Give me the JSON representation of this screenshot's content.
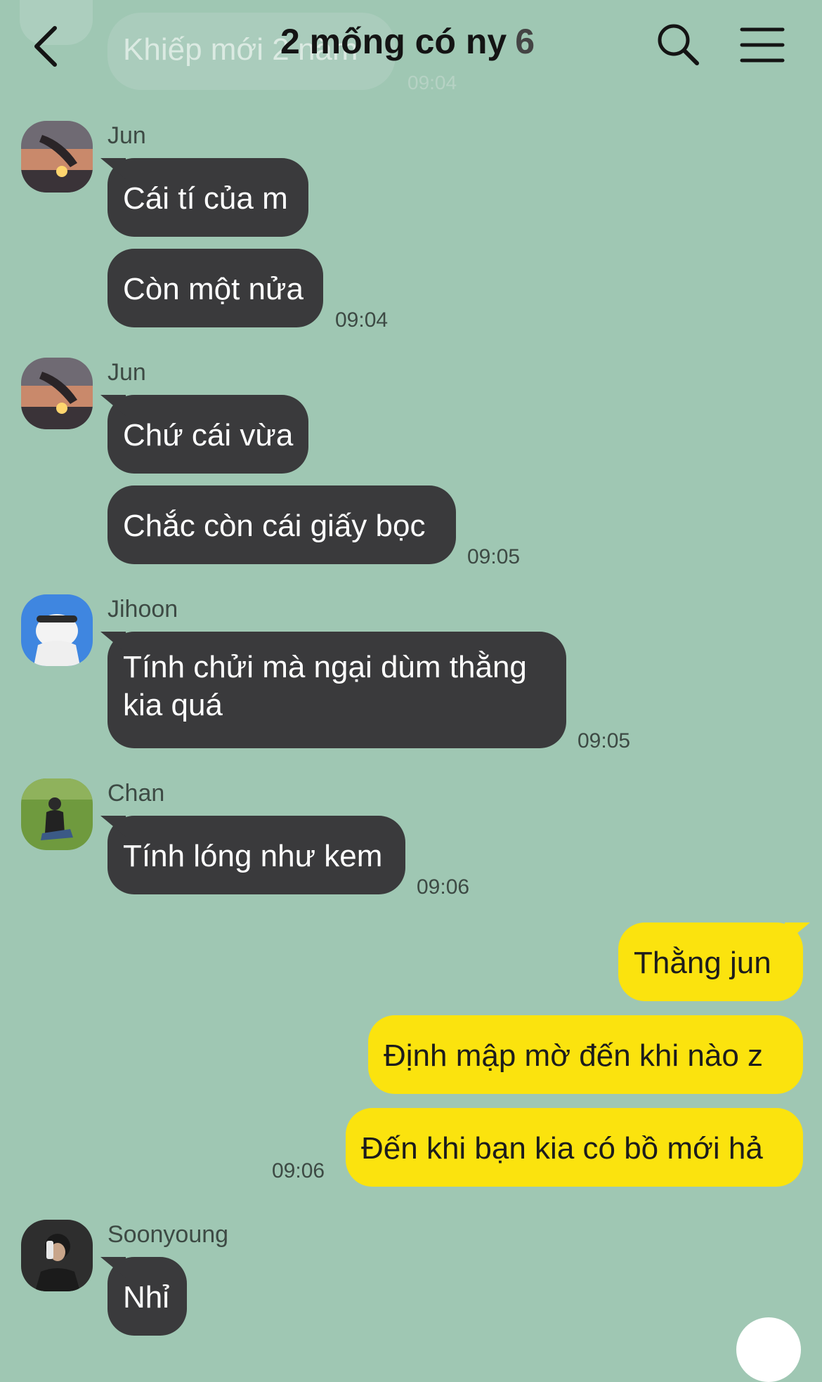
{
  "header": {
    "title": "2 mống có ny",
    "member_count": "6"
  },
  "previous_message": {
    "text": "Khiếp mới 2 năm",
    "time": "09:04"
  },
  "messages": [
    {
      "sender": "Jun",
      "bubbles": [
        "Cái tí của m",
        "Còn một nửa"
      ],
      "time": "09:04"
    },
    {
      "sender": "Jun",
      "bubbles": [
        "Chứ cái vừa",
        "Chắc còn cái giấy bọc"
      ],
      "time": "09:05"
    },
    {
      "sender": "Jihoon",
      "bubbles": [
        "Tính chửi mà ngại dùm thằng kia quá"
      ],
      "time": "09:05"
    },
    {
      "sender": "Chan",
      "bubbles": [
        "Tính lóng như kem"
      ],
      "time": "09:06"
    },
    {
      "sender": "me",
      "bubbles": [
        "Thằng jun",
        "Định mập mờ đến khi nào z",
        "Đến khi bạn kia có bồ mới hả"
      ],
      "time": "09:06"
    },
    {
      "sender": "Soonyoung",
      "bubbles": [
        "Nhỉ"
      ]
    }
  ],
  "colors": {
    "background": "#9fc7b3",
    "incoming_bubble": "#3a3a3c",
    "outgoing_bubble": "#fbe30e"
  },
  "icons": [
    "back-arrow-icon",
    "search-icon",
    "menu-icon"
  ]
}
